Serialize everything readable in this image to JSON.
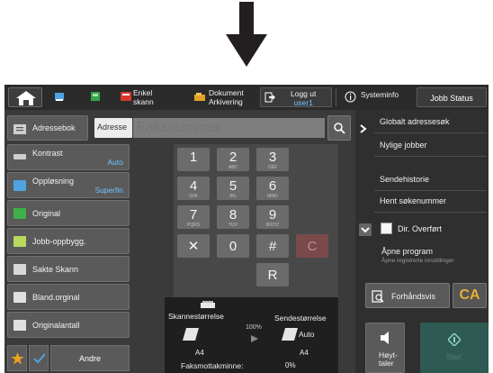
{
  "topbar": {
    "enkel_skann_line1": "Enkel",
    "enkel_skann_line2": "skann",
    "dokument_line1": "Dokument",
    "dokument_line2": "Arkivering",
    "logout_line1": "Logg ut",
    "logout_user": "user1",
    "systeminfo": "Systeminfo",
    "jobstatus": "Jobb Status"
  },
  "address": {
    "book_label": "Adressebok",
    "tab_label": "Adresse",
    "fax_placeholder": "Faksnummer"
  },
  "left": {
    "items": [
      {
        "label": "Kontrast",
        "value": "Auto"
      },
      {
        "label": "Oppløsning",
        "value": "Superfin"
      },
      {
        "label": "Original",
        "value": ""
      },
      {
        "label": "Jobb-oppbygg.",
        "value": ""
      },
      {
        "label": "Sakte Skann",
        "value": ""
      },
      {
        "label": "Bland.orginal",
        "value": ""
      },
      {
        "label": "Originalantall",
        "value": ""
      }
    ],
    "andre": "Andre"
  },
  "keypad": {
    "keys": [
      {
        "n": "1",
        "s": ""
      },
      {
        "n": "2",
        "s": "ABC"
      },
      {
        "n": "3",
        "s": "DEF"
      },
      {
        "n": "4",
        "s": "GHI"
      },
      {
        "n": "5",
        "s": "JKL"
      },
      {
        "n": "6",
        "s": "MNO"
      },
      {
        "n": "7",
        "s": "PQRS"
      },
      {
        "n": "8",
        "s": "TUV"
      },
      {
        "n": "9",
        "s": "WXYZ"
      },
      {
        "n": "✕",
        "s": ""
      },
      {
        "n": "0",
        "s": ""
      },
      {
        "n": "#",
        "s": ""
      },
      {
        "n": "R",
        "s": ""
      }
    ],
    "clear": "C"
  },
  "scan": {
    "skannestorrelse": "Skannestørrelse",
    "sendestorrelse": "Sendestørrelse",
    "ratio": "100%",
    "scan_size": "A4",
    "send_auto": "Auto",
    "send_size": "A4",
    "faksmottak_label": "Faksmottakminne:",
    "faksmottak_value": "0%"
  },
  "right": {
    "menu": [
      "Globalt adressesøk",
      "Nylige jobber",
      "Sendehistorie",
      "Hent søkenummer"
    ],
    "dir_overfort": "Dir. Overført",
    "apne_program": "Åpne program",
    "apne_sub": "Åpne registrerte innstillinger",
    "forhandsvis": "Forhåndsvis",
    "ca": "CA",
    "hoyttaler_line1": "Høyt-",
    "hoyttaler_line2": "taler",
    "start": "Start"
  },
  "colors": {
    "accent_blue": "#6ec3ff",
    "ca_gold": "#e4b035",
    "start_green": "#2f5a53"
  }
}
